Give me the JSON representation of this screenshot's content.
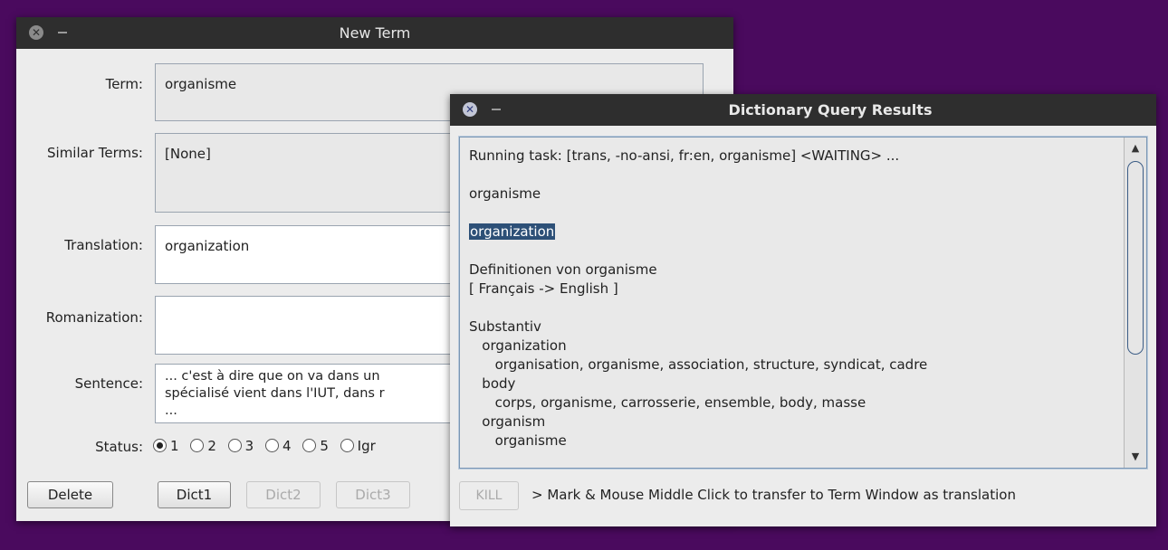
{
  "new_term": {
    "title": "New Term",
    "labels": {
      "term": "Term:",
      "similar": "Similar Terms:",
      "translation": "Translation:",
      "romanization": "Romanization:",
      "sentence": "Sentence:",
      "status": "Status:"
    },
    "term_value": "organisme",
    "similar_value": "[None]",
    "translation_value": "organization",
    "romanization_value": "",
    "sentence_lines": [
      "... c'est à dire que on va dans un",
      "spécialisé vient dans l'IUT, dans r",
      "..."
    ],
    "status_options": [
      "1",
      "2",
      "3",
      "4",
      "5",
      "Igr"
    ],
    "status_selected": "1",
    "buttons": {
      "delete": "Delete",
      "dict1": "Dict1",
      "dict2": "Dict2",
      "dict3": "Dict3"
    }
  },
  "dictionary": {
    "title": "Dictionary Query Results",
    "lines": {
      "l0": "Running task: [trans, -no-ansi, fr:en, organisme] <WAITING> ...",
      "l1": "organisme",
      "l2": "organization",
      "l3": "Definitionen von organisme",
      "l4": "[ Français -> English ]",
      "l5": "Substantiv",
      "l6": "   organization",
      "l7": "      organisation, organisme, association, structure, syndicat, cadre",
      "l8": "   body",
      "l9": "      corps, organisme, carrosserie, ensemble, body, masse",
      "l10": "   organism",
      "l11": "      organisme"
    },
    "kill_label": "KILL",
    "hint": "> Mark & Mouse Middle Click to transfer to Term Window as translation"
  },
  "colors": {
    "desktop": "#4a0a5e",
    "titlebar": "#2e2e2e",
    "selection": "#2d5077"
  }
}
